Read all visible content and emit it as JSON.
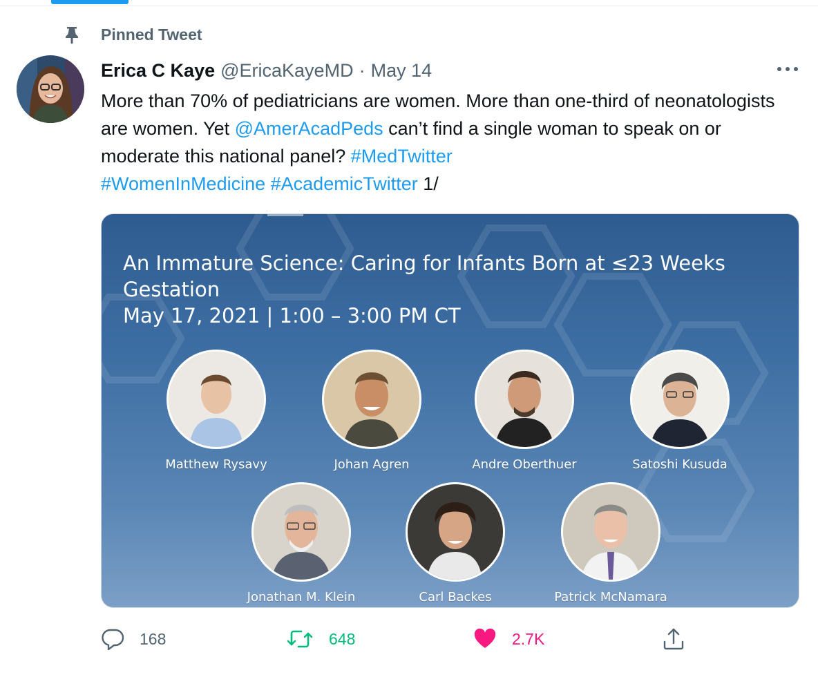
{
  "pinned_label": "Pinned Tweet",
  "tweet": {
    "author_name": "Erica C Kaye",
    "author_handle": "@EricaKayeMD",
    "separator": "·",
    "date": "May 14",
    "text_parts": {
      "p1": "More than 70% of pediatricians are women. More than one-third of neonatologists are women. Yet ",
      "mention": "@AmerAcadPeds",
      "p2": " can’t find a single woman to speak on or moderate this national panel? ",
      "hashtag1": "#MedTwitter",
      "hashtag2": "#WomenInMedicine",
      "hashtag3": "#AcademicTwitter",
      "p3": " 1/"
    }
  },
  "media": {
    "title": "An Immature Science: Caring for Infants Born at ≤23 Weeks Gestation",
    "datetime": "May 17, 2021 | 1:00 – 3:00 PM CT",
    "speakers": [
      {
        "name": "Matthew Rysavy"
      },
      {
        "name": "Johan Agren"
      },
      {
        "name": "Andre Oberthuer"
      },
      {
        "name": "Satoshi Kusuda"
      },
      {
        "name": "Jonathan M. Klein"
      },
      {
        "name": "Carl Backes"
      },
      {
        "name": "Patrick McNamara"
      }
    ]
  },
  "actions": {
    "replies": "168",
    "retweets": "648",
    "likes": "2.7K"
  },
  "colors": {
    "link": "#1d9bf0",
    "retweet": "#00ba7c",
    "like": "#f91880",
    "secondary_text": "#536471"
  },
  "icons": [
    "pin-icon",
    "more-icon",
    "reply-icon",
    "retweet-icon",
    "heart-icon",
    "share-icon"
  ]
}
